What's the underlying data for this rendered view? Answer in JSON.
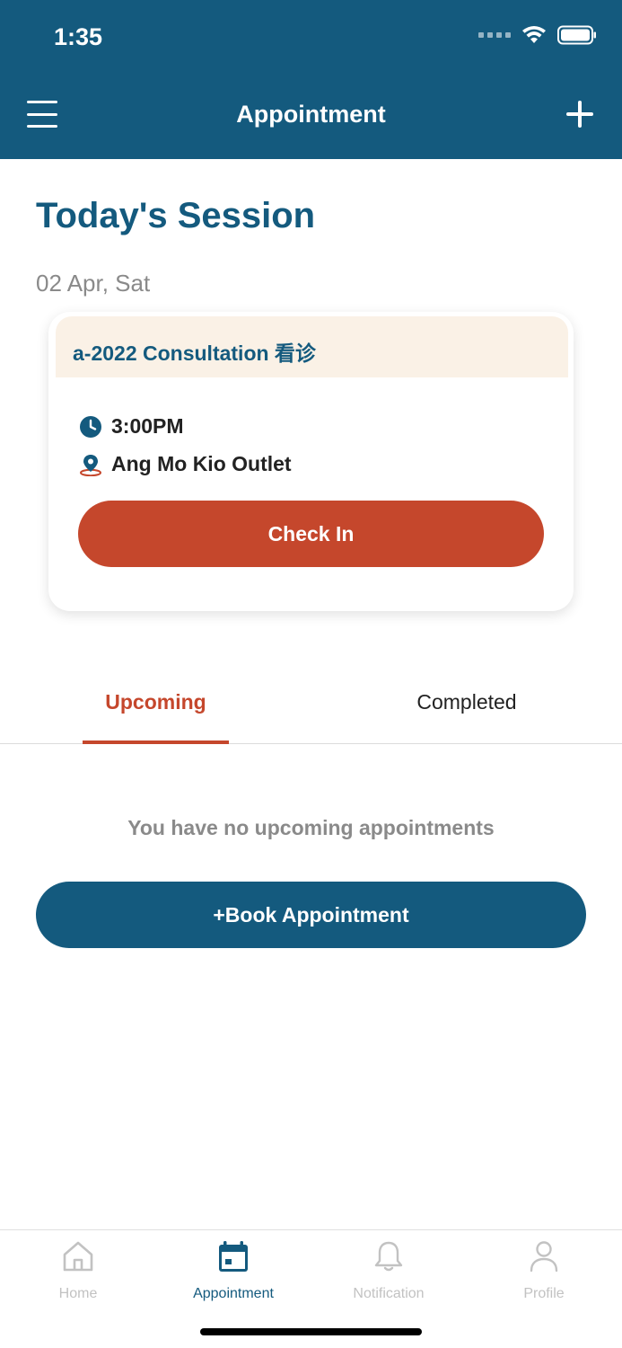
{
  "status_bar": {
    "time": "1:35"
  },
  "header": {
    "title": "Appointment"
  },
  "session": {
    "heading": "Today's Session",
    "date": "02 Apr, Sat",
    "card": {
      "title": "a-2022  Consultation 看诊",
      "time": "3:00PM",
      "location": "Ang Mo Kio Outlet",
      "checkin_label": "Check In"
    }
  },
  "tabs": [
    {
      "label": "Upcoming",
      "active": true
    },
    {
      "label": "Completed",
      "active": false
    }
  ],
  "empty_state": {
    "message": "You have no upcoming appointments",
    "book_label": "+Book Appointment"
  },
  "bottom_nav": [
    {
      "label": "Home",
      "icon": "home-icon",
      "active": false
    },
    {
      "label": "Appointment",
      "icon": "calendar-icon",
      "active": true
    },
    {
      "label": "Notification",
      "icon": "bell-icon",
      "active": false
    },
    {
      "label": "Profile",
      "icon": "user-icon",
      "active": false
    }
  ],
  "colors": {
    "primary": "#145a7e",
    "accent": "#c5472c",
    "card_header_bg": "#faf1e6",
    "muted_text": "#8a8a8a",
    "inactive_nav": "#c2c2c2"
  }
}
